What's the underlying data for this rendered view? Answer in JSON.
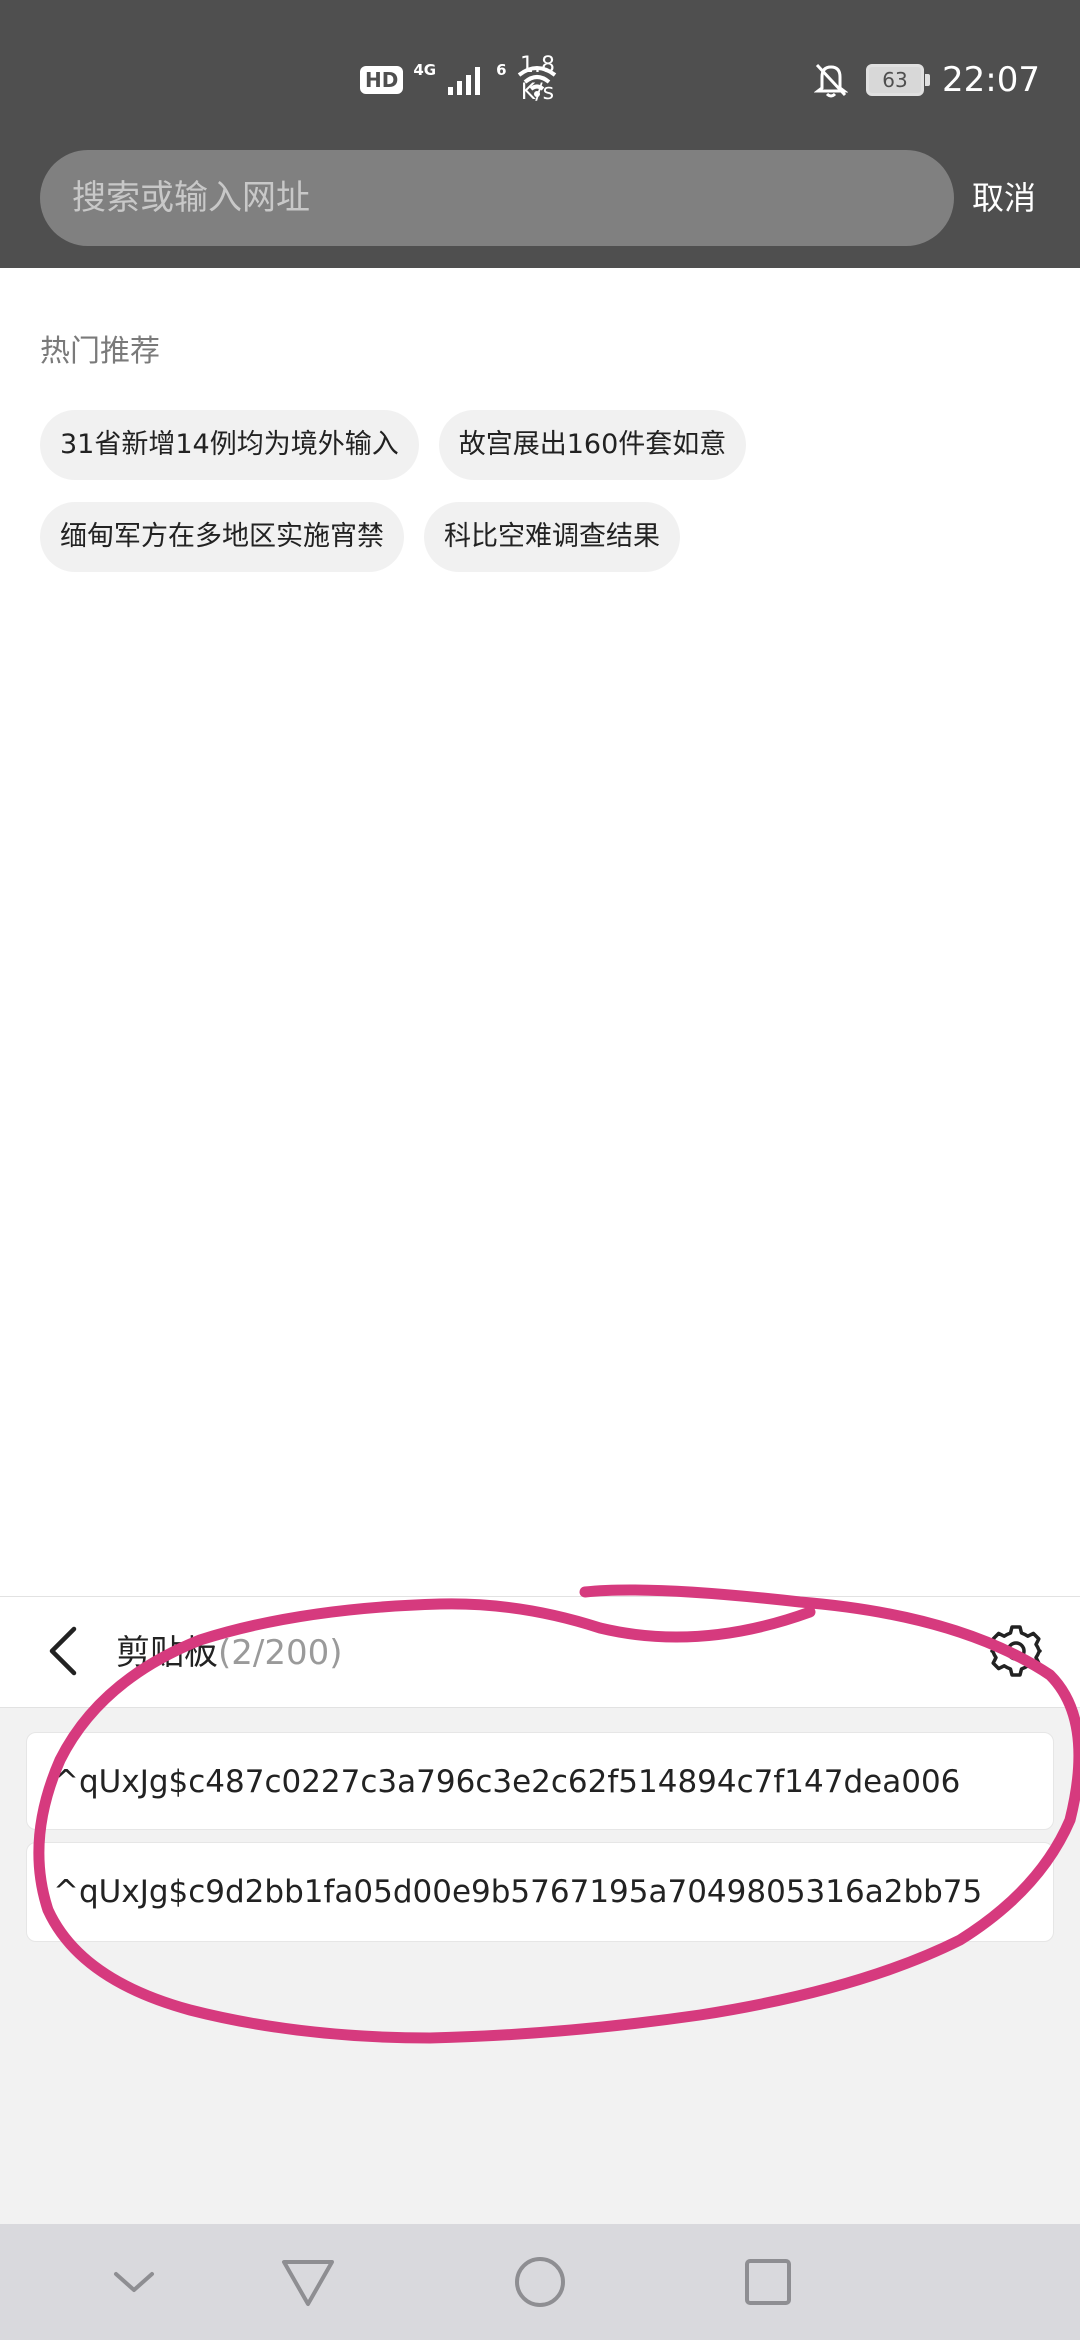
{
  "status_bar": {
    "hd_label": "HD",
    "network_label": "4G",
    "wifi_label": "6",
    "speed_value": "1.8",
    "speed_unit": "K/s",
    "battery_level": "63",
    "time": "22:07",
    "icons": [
      "hd-icon",
      "signal-icon",
      "wifi-icon",
      "notifications-off-icon",
      "battery-icon"
    ]
  },
  "search": {
    "placeholder": "搜索或输入网址",
    "value": "",
    "cancel_label": "取消"
  },
  "hot": {
    "title": "热门推荐",
    "rows": [
      [
        "31省新增14例均为境外输入",
        "故宫展出160件套如意"
      ],
      [
        "缅甸军方在多地区实施宵禁",
        "科比空难调查结果"
      ]
    ]
  },
  "clipboard": {
    "title": "剪贴板",
    "count": "(2/200)",
    "items": [
      "^qUxJg$c487c0227c3a796c3e2c62f514894c7f147dea006",
      "^qUxJg$c9d2bb1fa05d00e9b5767195a7049805316a2bb75"
    ],
    "icons": [
      "back-arrow-icon",
      "gear-icon"
    ]
  },
  "annotation": {
    "color": "#d63a7e"
  },
  "nav": {
    "icons": [
      "chevron-down-icon",
      "back-triangle-icon",
      "home-circle-icon",
      "recents-square-icon"
    ]
  }
}
